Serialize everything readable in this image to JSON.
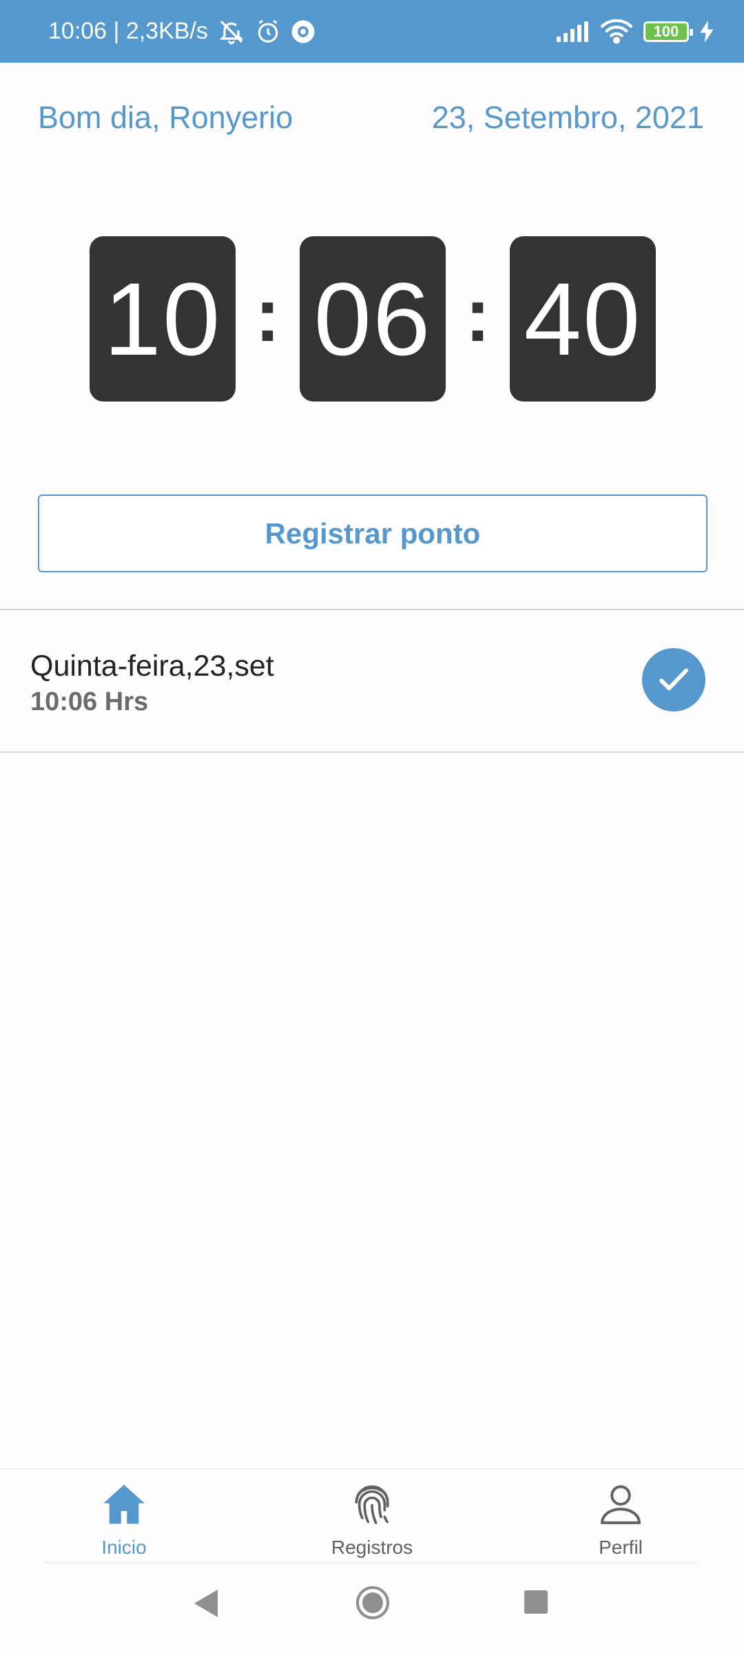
{
  "status_bar": {
    "time_speed": "10:06 | 2,3KB/s",
    "battery": "100",
    "icons": [
      "bell-off-icon",
      "alarm-icon",
      "settings-gear-icon",
      "signal-icon",
      "wifi-icon",
      "battery-icon",
      "charging-bolt-icon"
    ],
    "color": "#5598cd"
  },
  "header": {
    "greeting": "Bom dia, Ronyerio",
    "date": "23, Setembro, 2021"
  },
  "clock": {
    "hours": "10",
    "minutes": "06",
    "seconds": "40",
    "separator": ":"
  },
  "actions": {
    "register_label": "Registrar ponto"
  },
  "records": [
    {
      "day": "Quinta-feira,23,set",
      "time": "10:06 Hrs",
      "status_icon": "check-circle-icon"
    }
  ],
  "bottom_nav": {
    "items": [
      {
        "label": "Inicio",
        "icon": "home-icon",
        "active": true
      },
      {
        "label": "Registros",
        "icon": "fingerprint-icon",
        "active": false
      },
      {
        "label": "Perfil",
        "icon": "user-icon",
        "active": false
      }
    ]
  },
  "system_nav": {
    "icons": [
      "back-icon",
      "home-circle-icon",
      "recents-icon"
    ]
  },
  "colors": {
    "accent": "#5598cd",
    "clock_bg": "#343334",
    "text_dark": "#222222",
    "text_muted": "#6b6b6b"
  }
}
